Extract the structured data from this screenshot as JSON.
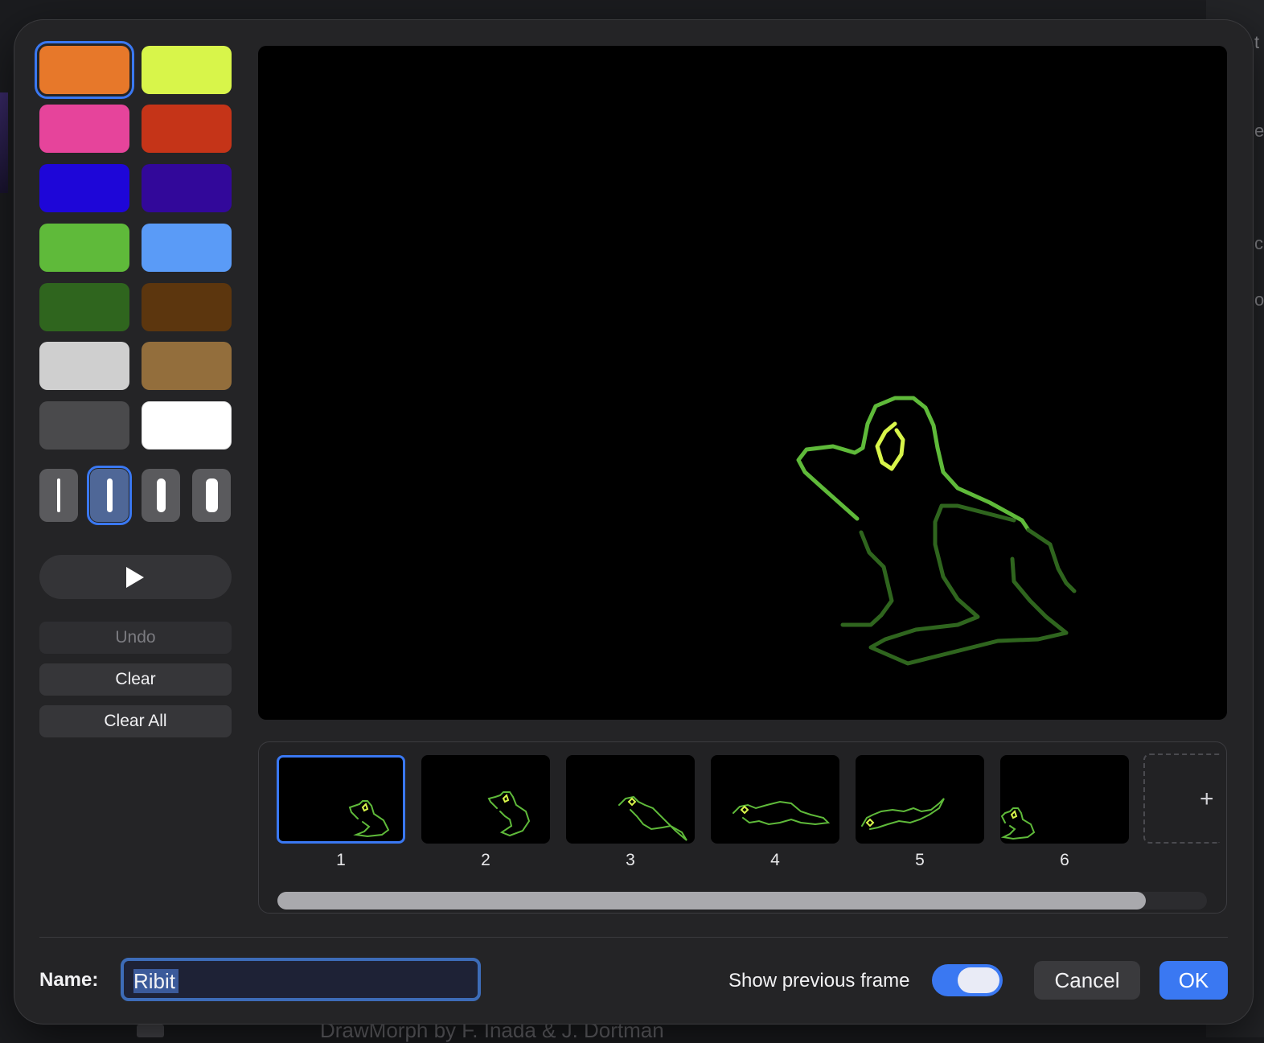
{
  "palette": {
    "colors": [
      "#e7782a",
      "#d8f54a",
      "#e6449b",
      "#c53418",
      "#1e06d8",
      "#32089a",
      "#5fba3a",
      "#5a9bf7",
      "#2f651e",
      "#5c360e",
      "#cfcfcf",
      "#936e3c",
      "#4a4a4c",
      "#ffffff"
    ],
    "selected_index": 0
  },
  "brushes": {
    "count": 4,
    "selected_index": 1
  },
  "controls": {
    "play_icon": "play-icon",
    "undo_label": "Undo",
    "clear_label": "Clear",
    "clear_all_label": "Clear All"
  },
  "drawing": {
    "stroke_colors": [
      "#5fba3a",
      "#d8f54a",
      "#2f651e"
    ]
  },
  "frames": {
    "items": [
      {
        "label": "1"
      },
      {
        "label": "2"
      },
      {
        "label": "3"
      },
      {
        "label": "4"
      },
      {
        "label": "5"
      },
      {
        "label": "6"
      }
    ],
    "selected_index": 0,
    "add_icon": "plus-icon",
    "scroll_position": 0
  },
  "footer": {
    "name_label": "Name:",
    "name_value": "Ribit",
    "show_previous_label": "Show previous frame",
    "show_previous_on": true,
    "cancel_label": "Cancel",
    "ok_label": "OK"
  },
  "background": {
    "bottom_text": "DrawMorph by F. Inada & J. Dortman",
    "right_edge_chars": [
      "t",
      "e",
      "c",
      "o"
    ]
  }
}
